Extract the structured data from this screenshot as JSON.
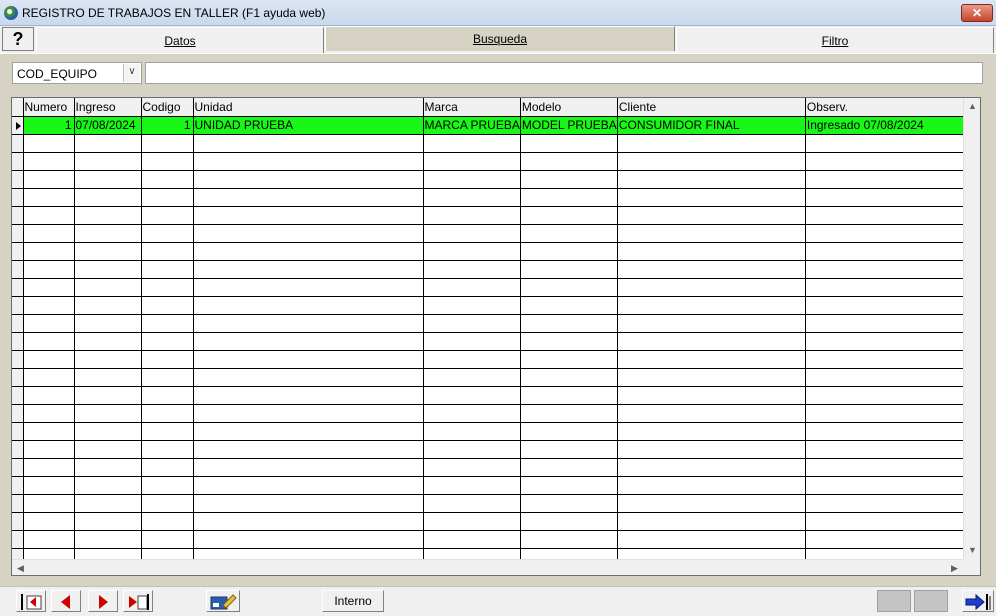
{
  "window": {
    "title": "REGISTRO DE TRABAJOS EN TALLER (F1 ayuda web)",
    "close_label": "✕"
  },
  "tabs": [
    {
      "label": "Datos",
      "active": false
    },
    {
      "label": "Busqueda",
      "active": true
    },
    {
      "label": "Filtro",
      "active": false
    }
  ],
  "help_label": "?",
  "search": {
    "field": "COD_EQUIPO",
    "value": "",
    "placeholder": ""
  },
  "grid": {
    "columns": [
      "Numero",
      "Ingreso",
      "Codigo",
      "Unidad",
      "Marca",
      "Modelo",
      "Cliente",
      "Observ."
    ],
    "rows": [
      {
        "numero": "1",
        "ingreso": "07/08/2024",
        "codigo": "1",
        "unidad": "UNIDAD PRUEBA",
        "marca": "MARCA PRUEBA",
        "modelo": "MODEL PRUEBA",
        "cliente": "CONSUMIDOR FINAL",
        "observ": "Ingresado 07/08/2024"
      }
    ],
    "selected_row_color": "#19f719"
  },
  "toolbar": {
    "first_icon": "first-record-icon",
    "prev_icon": "prev-record-icon",
    "next_icon": "next-record-icon",
    "last_icon": "last-record-icon",
    "edit_icon": "edit-record-icon",
    "interno_label": "Interno",
    "exit_icon": "exit-icon"
  }
}
